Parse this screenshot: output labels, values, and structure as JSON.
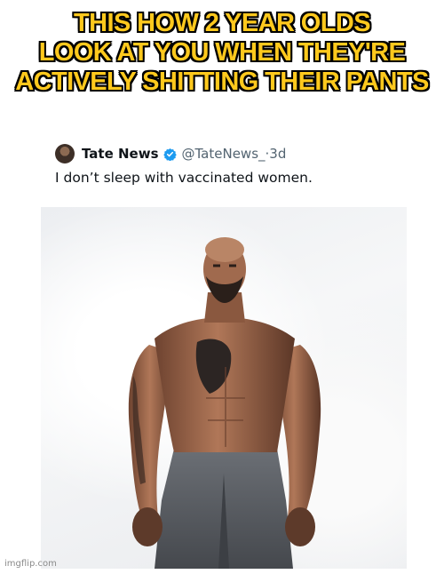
{
  "meme": {
    "caption_lines": [
      "THIS HOW 2 YEAR OLDS",
      "LOOK AT YOU WHEN THEY'RE",
      "ACTIVELY SHITTING THEIR PANTS"
    ],
    "caption_color": "#ffc91d",
    "watermark": "imgflip.com"
  },
  "tweet": {
    "author_name": "Tate News",
    "verified_icon": "verified-badge-icon",
    "verified_color": "#1d9bf0",
    "handle": "@TateNews_",
    "separator": "·",
    "time": "3d",
    "text": "I don’t sleep with vaccinated women."
  },
  "photo": {
    "subject": "shirtless-man-photo"
  }
}
